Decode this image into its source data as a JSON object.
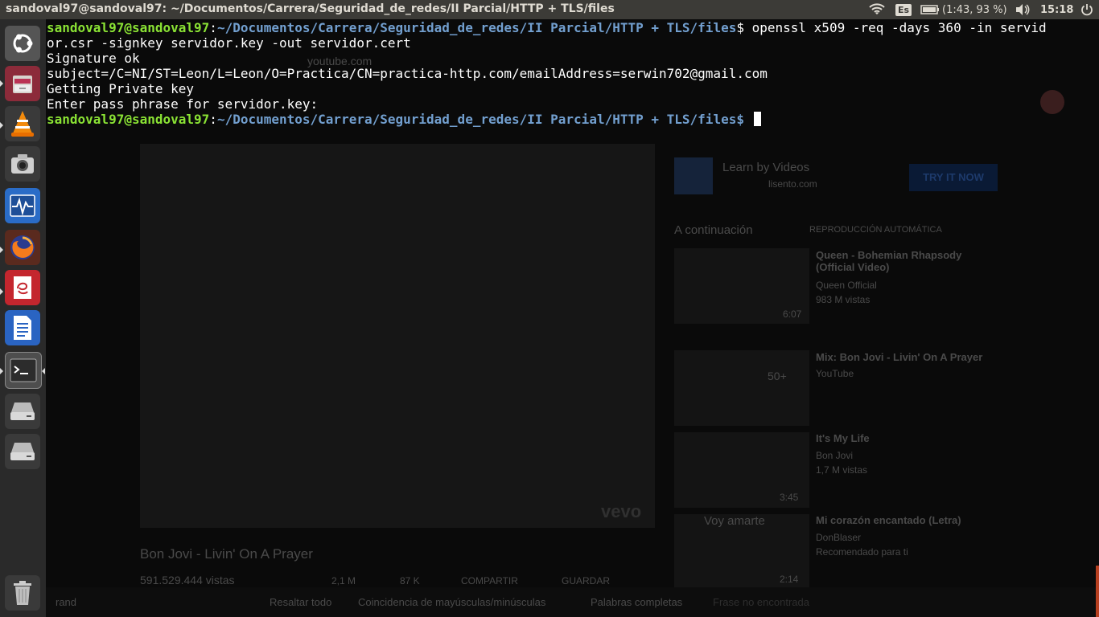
{
  "topbar": {
    "window_title": "sandoval97@sandoval97: ~/Documentos/Carrera/Seguridad_de_redes/II Parcial/HTTP + TLS/files",
    "keyboard_layout": "Es",
    "battery": "(1:43, 93 %)",
    "clock": "15:18",
    "icons": [
      "wifi-icon",
      "keyboard-icon",
      "battery-icon",
      "volume-icon",
      "power-icon"
    ]
  },
  "launcher": {
    "items": [
      "ubuntu-dash-icon",
      "files-icon",
      "vlc-icon",
      "camera-icon",
      "system-monitor-icon",
      "firefox-icon",
      "evince-icon",
      "libreoffice-writer-icon",
      "terminal-icon",
      "disk-drive-icon",
      "disk-drive-icon",
      "trash-icon"
    ]
  },
  "terminal": {
    "line1_prompt_user": "sandoval97@sandoval97",
    "line1_prompt_path": "~/Documentos/Carrera/Seguridad_de_redes/II Parcial/HTTP + TLS/files",
    "line1_command": "$ openssl x509 -req -days 360 -in servid",
    "line2": "or.csr -signkey servidor.key -out servidor.cert",
    "line3": "Signature ok",
    "line4": "subject=/C=NI/ST=Leon/L=Leon/O=Practica/CN=practica-http.com/emailAddress=serwin702@gmail.com",
    "line5": "Getting Private key",
    "line6": "Enter pass phrase for servidor.key:",
    "line7_prompt_user": "sandoval97@sandoval97",
    "line7_prompt_path": "~/Documentos/Carrera/Seguridad_de_redes/II Parcial/HTTP + TLS/files",
    "line7_symbol": "$ ",
    "colors": {
      "user": "#8ae234",
      "path": "#729fcf",
      "text": "#ffffff"
    }
  },
  "background_browser": {
    "url": "youtube.com",
    "ad_title": "Learn by Videos",
    "ad_domain": "lisento.com",
    "ad_button": "TRY IT NOW",
    "up_next": "A continuación",
    "autoplay": "REPRODUCCIÓN AUTOMÁTICA",
    "video_title": "Bon Jovi - Livin' On A Prayer",
    "video_views": "591.529.444 vistas",
    "likes": "2,1 M",
    "dislikes": "87 K",
    "share": "COMPARTIR",
    "save": "GUARDAR",
    "watermark": "vevo",
    "suggestions": [
      {
        "title": "Queen - Bohemian Rhapsody (Official Video)",
        "channel": "Queen Official",
        "views": "983 M vistas",
        "duration": "6:07"
      },
      {
        "title": "Mix: Bon Jovi - Livin' On A Prayer",
        "channel": "YouTube",
        "badge": "50+"
      },
      {
        "title": "It's My Life",
        "channel": "Bon Jovi",
        "views": "1,7 M vistas",
        "duration": "3:45"
      },
      {
        "title": "Mi corazón encantado (Letra)",
        "channel": "DonBlaser",
        "extra": "Recomendado para ti",
        "duration": "2:14",
        "thumb_text": "Voy amarte"
      }
    ],
    "findbar": {
      "query": "rand",
      "highlight_all": "Resaltar todo",
      "match_case": "Coincidencia de mayúsculas/minúsculas",
      "whole_words": "Palabras completas",
      "no_results": "Frase no encontrada"
    }
  }
}
